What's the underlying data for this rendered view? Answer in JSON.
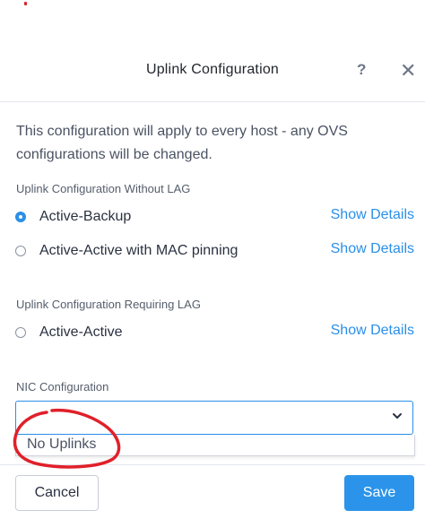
{
  "dialog": {
    "title": "Uplink Configuration",
    "help_glyph": "?",
    "close_glyph": "✕"
  },
  "description": "This configuration will apply to every host - any OVS configurations will be changed.",
  "without_lag": {
    "label": "Uplink Configuration Without LAG",
    "options": [
      {
        "label": "Active-Backup",
        "selected": true,
        "details_link": "Show Details"
      },
      {
        "label": "Active-Active with MAC pinning",
        "selected": false,
        "details_link": "Show Details"
      }
    ]
  },
  "requiring_lag": {
    "label": "Uplink Configuration Requiring LAG",
    "options": [
      {
        "label": "Active-Active",
        "selected": false,
        "details_link": "Show Details"
      }
    ]
  },
  "nic_config": {
    "label": "NIC Configuration",
    "selected_value": "",
    "dropdown_options": [
      "No Uplinks"
    ]
  },
  "footer": {
    "cancel_label": "Cancel",
    "save_label": "Save"
  },
  "colors": {
    "accent": "#2b94ea",
    "annotation": "#e0202a"
  },
  "icons": {
    "help": "question-mark-icon",
    "close": "close-icon",
    "dropdown": "chevron-down-icon"
  }
}
